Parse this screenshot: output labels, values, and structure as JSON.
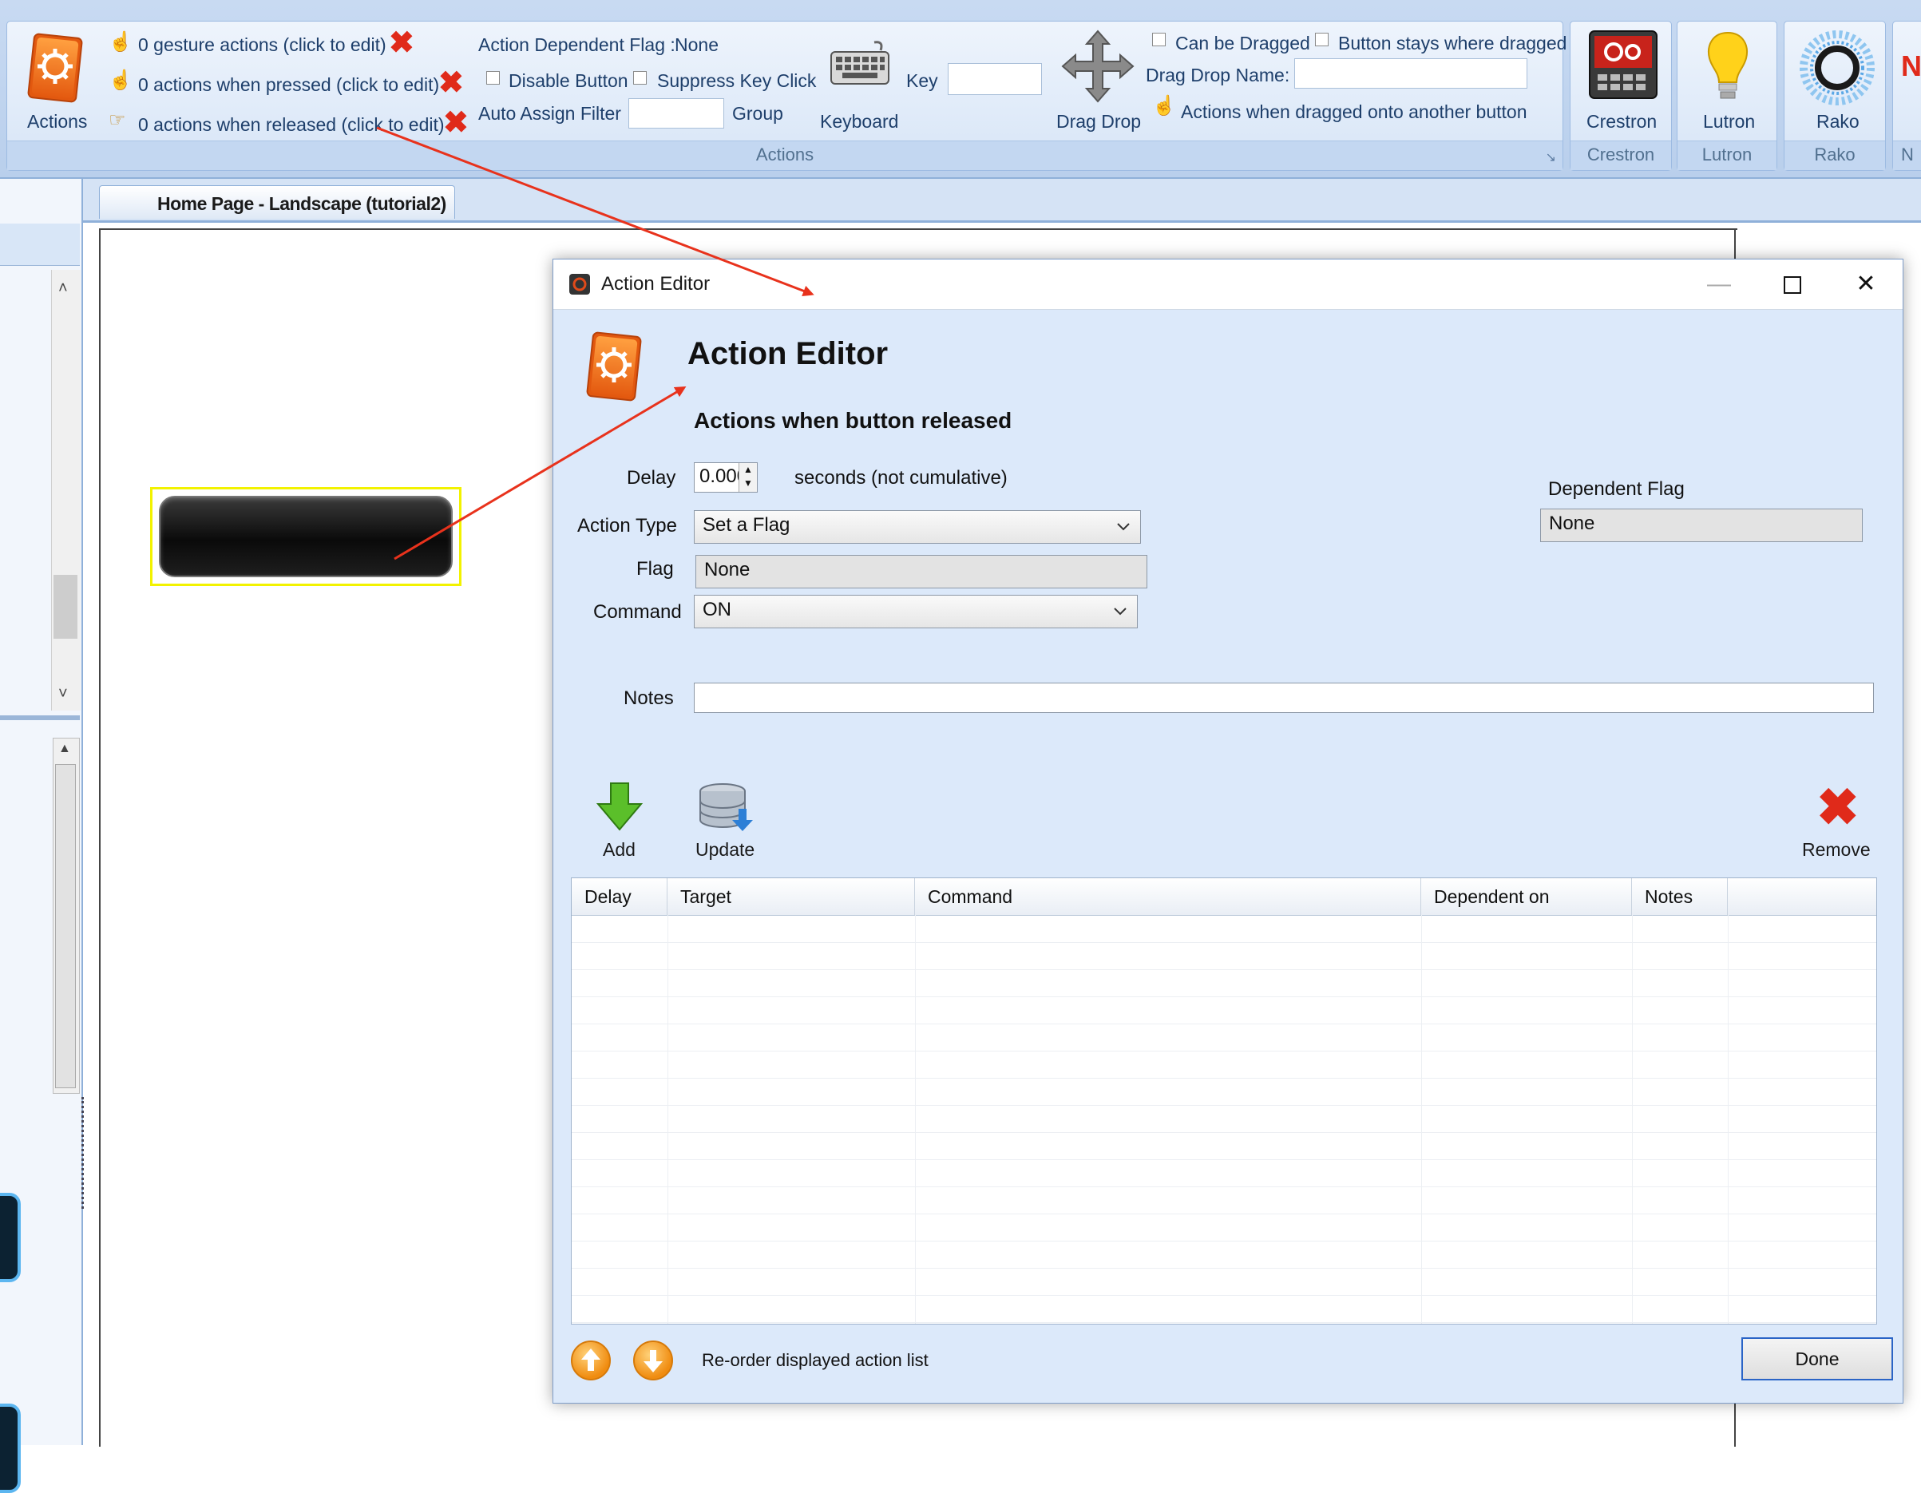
{
  "ribbon": {
    "actions_group": {
      "big_button_label": "Actions",
      "gesture_link": "0 gesture actions (click to edit)",
      "pressed_link": "0 actions when pressed (click to edit)",
      "released_link": "0 actions when released (click to edit)",
      "dependent_flag_label": "Action Dependent Flag :",
      "dependent_flag_value": "None",
      "disable_button": "Disable Button",
      "suppress_key_click": "Suppress Key Click",
      "auto_assign_filter": "Auto Assign Filter",
      "group_label": "Group",
      "keyboard_label": "Keyboard",
      "key_label": "Key",
      "drag_drop_label": "Drag Drop",
      "can_be_dragged": "Can be Dragged",
      "button_stays": "Button stays where dragged",
      "drag_drop_name": "Drag Drop Name:",
      "dragged_onto": "Actions when dragged onto another button",
      "footer": "Actions"
    },
    "crestron": {
      "label": "Crestron",
      "footer": "Crestron"
    },
    "lutron": {
      "label": "Lutron",
      "footer": "Lutron"
    },
    "rako": {
      "label": "Rako",
      "footer": "Rako"
    },
    "next_footer": "N",
    "next_logo": "N"
  },
  "document_tab": "Home Page - Landscape (tutorial2)",
  "dialog": {
    "window_title": "Action Editor",
    "heading": "Action Editor",
    "subheading": "Actions when button released",
    "delay_label": "Delay",
    "delay_value": "0.000",
    "delay_suffix": "seconds (not cumulative)",
    "action_type_label": "Action Type",
    "action_type_value": "Set a Flag",
    "flag_label": "Flag",
    "flag_value": "None",
    "command_label": "Command",
    "command_value": "ON",
    "dependent_flag_label": "Dependent Flag",
    "dependent_flag_value": "None",
    "notes_label": "Notes",
    "notes_value": "",
    "add_label": "Add",
    "update_label": "Update",
    "remove_label": "Remove",
    "columns": [
      "Delay",
      "Target",
      "Command",
      "Dependent on",
      "Notes"
    ],
    "reorder_label": "Re-order displayed action list",
    "done_label": "Done"
  },
  "colors": {
    "ribbon_bg": "#b9cfec",
    "dialog_bg": "#dce9fa",
    "accent_red": "#e02a1a",
    "highlight_yellow": "#f2f200",
    "done_border": "#2a64c6"
  }
}
